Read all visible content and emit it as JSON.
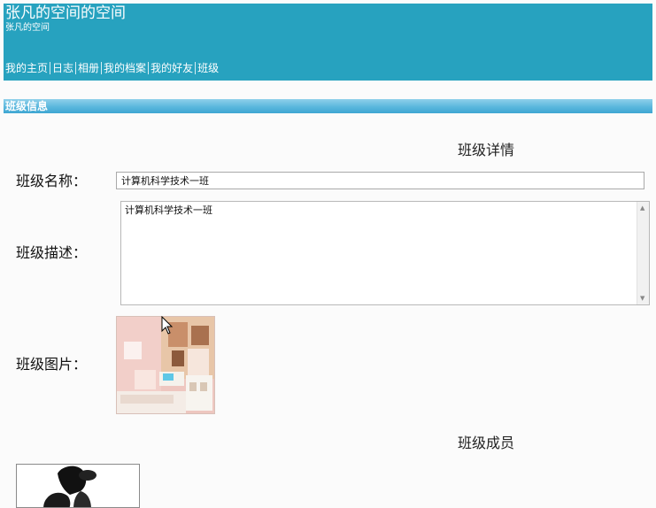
{
  "header": {
    "title": "张凡的空间的空间",
    "subtitle": "张凡的空间",
    "nav": [
      "我的主页",
      "日志",
      "相册",
      "我的档案",
      "我的好友",
      "班级"
    ]
  },
  "section": {
    "title": "班级信息"
  },
  "details": {
    "heading": "班级详情",
    "name_label": "班级名称：",
    "name_value": "计算机科学技术一班",
    "desc_label": "班级描述：",
    "desc_value": "计算机科学技术一班",
    "image_label": "班级图片："
  },
  "members": {
    "heading": "班级成员"
  },
  "colors": {
    "header_bg": "#27a2bf",
    "section_bar": "#5ab7dd"
  },
  "icons": {
    "scroll_up": "scroll-up-arrow-icon",
    "scroll_down": "scroll-down-arrow-icon",
    "cursor": "mouse-pointer-icon"
  }
}
